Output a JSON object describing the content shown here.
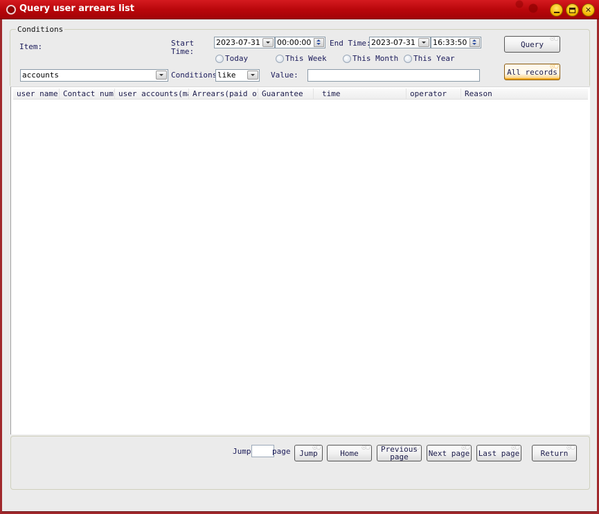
{
  "window": {
    "title": "Query user arrears list",
    "controls": {
      "minimize": "minimize",
      "maximize": "maximize",
      "close": "close"
    }
  },
  "conditions": {
    "legend": "Conditions",
    "item_label": "Item:",
    "item_value": "accounts",
    "start_time_label": "Start Time:",
    "start_date": "2023-07-31",
    "start_clock": "00:00:00",
    "end_time_label": "End Time:",
    "end_date": "2023-07-31",
    "end_clock": "16:33:50",
    "radios": [
      {
        "label": "Today",
        "checked": false
      },
      {
        "label": "This Week",
        "checked": false
      },
      {
        "label": "This Month",
        "checked": false
      },
      {
        "label": "This Year",
        "checked": false
      }
    ],
    "conditions_label": "Conditions:",
    "conditions_value": "like",
    "value_label": "Value:",
    "value_input": "",
    "query_button": "Query",
    "all_records_button": "All records"
  },
  "table": {
    "columns": [
      "user name",
      "Contact numl",
      "user accounts(ma",
      "Arrears(paid of",
      "Guarantee",
      "time",
      "operator",
      "Reason"
    ],
    "rows": []
  },
  "pagination": {
    "jump_label": "Jump",
    "page_label": "page",
    "page_input": "",
    "jump_button": "Jump",
    "home_button": "Home",
    "previous_button": "Previous page",
    "next_button": "Next page",
    "last_button": "Last page",
    "return_button": "Return"
  }
}
